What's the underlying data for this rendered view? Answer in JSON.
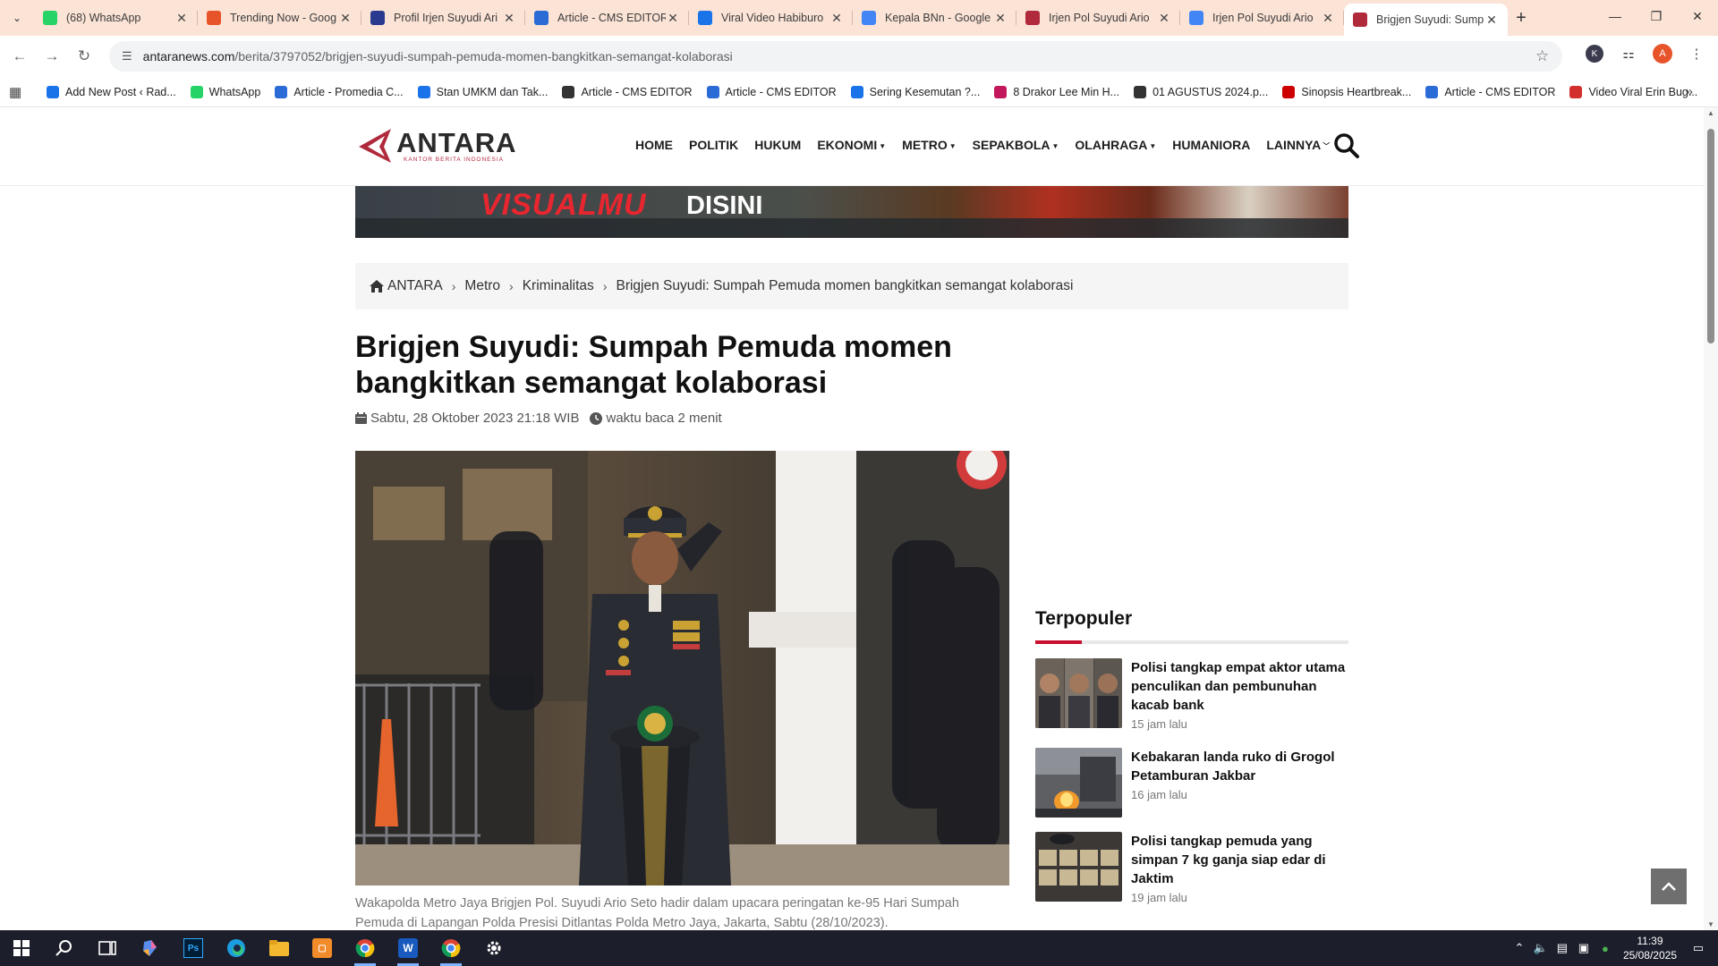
{
  "browser": {
    "tabs": [
      {
        "title": "(68) WhatsApp",
        "favicon": "whatsapp-icon",
        "color": "#25d366"
      },
      {
        "title": "Trending Now - Goog",
        "favicon": "trends-icon",
        "color": "#e8542a"
      },
      {
        "title": "Profil Irjen Suyudi Ari",
        "favicon": "news-icon",
        "color": "#2a3a8f"
      },
      {
        "title": "Article - CMS EDITOR",
        "favicon": "cms-icon",
        "color": "#2a6bd6"
      },
      {
        "title": "Viral Video Habiburo",
        "favicon": "doc-icon",
        "color": "#1a73e8"
      },
      {
        "title": "Kepala BNn - Google",
        "favicon": "google-icon",
        "color": "#4285f4"
      },
      {
        "title": "Irjen Pol Suyudi Ario",
        "favicon": "antara-icon",
        "color": "#b02a3c"
      },
      {
        "title": "Irjen Pol Suyudi Ario",
        "favicon": "google-icon",
        "color": "#4285f4"
      },
      {
        "title": "Brigjen Suyudi: Sump",
        "favicon": "antara-icon",
        "color": "#b02a3c"
      }
    ],
    "url_host": "antaranews.com",
    "url_path": "/berita/3797052/brigjen-suyudi-sumpah-pemuda-momen-bangkitkan-semangat-kolaborasi",
    "avatar_letter": "A",
    "extension_letter": "K",
    "bookmarks": [
      {
        "label": "Add New Post ‹ Rad...",
        "color": "#1a73e8"
      },
      {
        "label": "WhatsApp",
        "color": "#25d366"
      },
      {
        "label": "Article - Promedia C...",
        "color": "#2a6bd6"
      },
      {
        "label": "Stan UMKM dan Tak...",
        "color": "#1a73e8"
      },
      {
        "label": "Article - CMS EDITOR",
        "color": "#333333"
      },
      {
        "label": "Article - CMS EDITOR",
        "color": "#2a6bd6"
      },
      {
        "label": "Sering Kesemutan ?...",
        "color": "#1a73e8"
      },
      {
        "label": "8 Drakor Lee Min H...",
        "color": "#c2185b"
      },
      {
        "label": "01 AGUSTUS 2024.p...",
        "color": "#333333"
      },
      {
        "label": "Sinopsis Heartbreak...",
        "color": "#cc0000"
      },
      {
        "label": "Article - CMS EDITOR",
        "color": "#2a6bd6"
      },
      {
        "label": "Video Viral Erin Bug...",
        "color": "#d32f2f"
      }
    ]
  },
  "site": {
    "logo_text": "ANTARA",
    "logo_subtext": "KANTOR BERITA INDONESIA",
    "accent": "#c8102e",
    "nav": [
      {
        "label": "HOME",
        "dropdown": false
      },
      {
        "label": "POLITIK",
        "dropdown": false
      },
      {
        "label": "HUKUM",
        "dropdown": false
      },
      {
        "label": "EKONOMI",
        "dropdown": true
      },
      {
        "label": "METRO",
        "dropdown": true
      },
      {
        "label": "SEPAKBOLA",
        "dropdown": true
      },
      {
        "label": "OLAHRAGA",
        "dropdown": true
      },
      {
        "label": "HUMANIORA",
        "dropdown": false
      },
      {
        "label": "LAINNYA",
        "dropdown": true
      }
    ],
    "banner_text_1": "VISUALMU",
    "banner_text_2": "DISINI"
  },
  "breadcrumb": [
    "ANTARA",
    "Metro",
    "Kriminalitas",
    "Brigjen Suyudi: Sumpah Pemuda momen bangkitkan semangat kolaborasi"
  ],
  "article": {
    "title": "Brigjen Suyudi: Sumpah Pemuda momen bangkitkan semangat kolaborasi",
    "date": "Sabtu, 28 Oktober 2023 21:18 WIB",
    "read_time": "waktu baca 2 menit",
    "caption": "Wakapolda Metro Jaya Brigjen Pol. Suyudi Ario Seto hadir dalam upacara peringatan ke-95 Hari Sumpah Pemuda di Lapangan Polda Presisi Ditlantas Polda Metro Jaya, Jakarta, Sabtu (28/10/2023)."
  },
  "sidebar": {
    "title": "Terpopuler",
    "items": [
      {
        "title": "Polisi tangkap empat aktor utama penculikan dan pembunuhan kacab bank",
        "time": "15 jam lalu"
      },
      {
        "title": "Kebakaran landa ruko di Grogol Petamburan Jakbar",
        "time": "16 jam lalu"
      },
      {
        "title": "Polisi tangkap pemuda yang simpan 7 kg ganja siap edar di Jaktim",
        "time": "19 jam lalu"
      }
    ]
  },
  "taskbar": {
    "time": "11:39",
    "date": "25/08/2025"
  }
}
